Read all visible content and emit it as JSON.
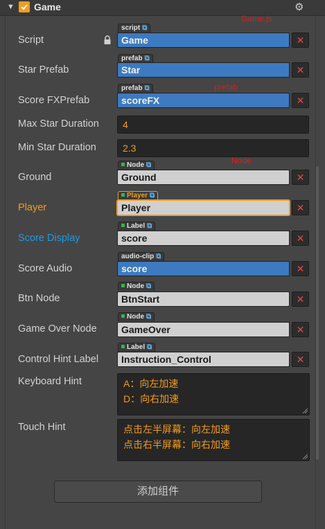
{
  "component": {
    "title": "Game"
  },
  "annotations": {
    "game_js": "Game.js",
    "prefab": "prefab",
    "node": "Node"
  },
  "rows": {
    "script": {
      "label": "Script",
      "tag": "script",
      "value": "Game",
      "clear": "✕"
    },
    "star_prefab": {
      "label": "Star Prefab",
      "tag": "prefab",
      "value": "Star",
      "clear": "✕"
    },
    "score_fx_prefab": {
      "label": "Score FXPrefab",
      "tag": "prefab",
      "value": "scoreFX",
      "clear": "✕"
    },
    "max_star_duration": {
      "label": "Max Star Duration",
      "value": "4"
    },
    "min_star_duration": {
      "label": "Min Star Duration",
      "value": "2.3"
    },
    "ground": {
      "label": "Ground",
      "tag": "Node",
      "value": "Ground",
      "clear": "✕"
    },
    "player": {
      "label": "Player",
      "tag": "Player",
      "value": "Player",
      "clear": "✕"
    },
    "score_display": {
      "label": "Score Display",
      "tag": "Label",
      "value": "score",
      "clear": "✕"
    },
    "score_audio": {
      "label": "Score Audio",
      "tag": "audio-clip",
      "value": "score",
      "clear": "✕"
    },
    "btn_node": {
      "label": "Btn Node",
      "tag": "Node",
      "value": "BtnStart",
      "clear": "✕"
    },
    "game_over_node": {
      "label": "Game Over Node",
      "tag": "Node",
      "value": "GameOver",
      "clear": "✕"
    },
    "control_hint_label": {
      "label": "Control Hint Label",
      "tag": "Label",
      "value": "Instruction_Control",
      "clear": "✕"
    },
    "keyboard_hint": {
      "label": "Keyboard Hint",
      "line1": "A：向左加速",
      "line2": "D：向右加速"
    },
    "touch_hint": {
      "label": "Touch Hint",
      "line1": "点击左半屏幕：向左加速",
      "line2": "点击右半屏幕：向右加速"
    }
  },
  "add_component_button": "添加组件",
  "colors": {
    "accent": "#f39c1d",
    "link_blue": "#1e9ae0",
    "field_blue": "#3d7ac0",
    "danger": "#e04a4a"
  }
}
